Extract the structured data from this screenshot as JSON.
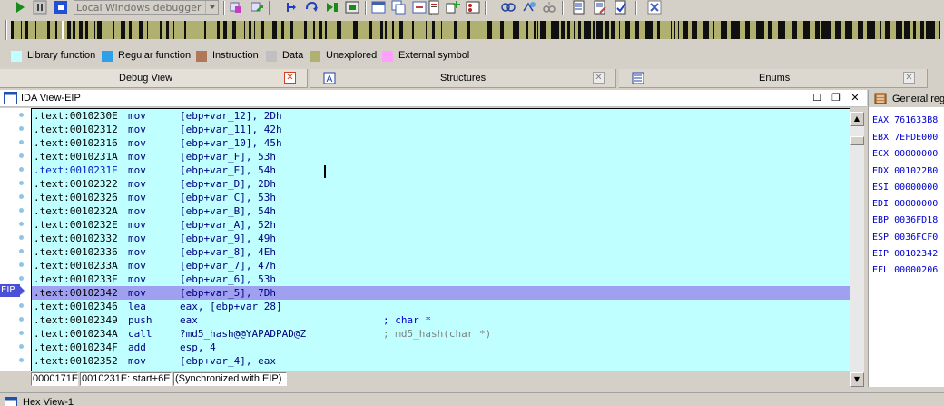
{
  "toolbar": {
    "buttons": [
      {
        "name": "start-process-button",
        "icon": "play-icon"
      },
      {
        "name": "pause-process-button",
        "icon": "pause-icon"
      },
      {
        "name": "terminate-process-button",
        "icon": "stop-icon"
      },
      {
        "name": "attach-process-button",
        "icon": "attach-icon"
      },
      {
        "name": "detach-process-button",
        "icon": "detach-icon"
      },
      {
        "name": "step-into-button",
        "icon": "step-into-icon"
      },
      {
        "name": "step-over-button",
        "icon": "step-over-icon"
      },
      {
        "name": "run-to-cursor-button",
        "icon": "run-to-cursor-icon"
      },
      {
        "name": "run-until-return-button",
        "icon": "run-until-return-icon"
      }
    ],
    "debugger_select": {
      "value": "Local Windows debugger"
    }
  },
  "legend": {
    "items": [
      {
        "label": "Library function",
        "color": "#c0ffff"
      },
      {
        "label": "Regular function",
        "color": "#2ca0e8"
      },
      {
        "label": "Instruction",
        "color": "#b07858"
      },
      {
        "label": "Data",
        "color": "#c0c0c0"
      },
      {
        "label": "Unexplored",
        "color": "#b0b070"
      },
      {
        "label": "External symbol",
        "color": "#ffa0ff"
      }
    ]
  },
  "tabs": [
    {
      "label": "Debug View",
      "active": true
    },
    {
      "label": "Structures",
      "active": false
    },
    {
      "label": "Enums",
      "active": false
    }
  ],
  "ida_view": {
    "title": "IDA View-EIP",
    "eip_marker": "EIP",
    "lines": [
      {
        "addr": ".text:0010230E",
        "mnem": "mov",
        "ops": "[ebp+var_12], 2Dh",
        "comment": "",
        "selected": false,
        "highlight": false
      },
      {
        "addr": ".text:00102312",
        "mnem": "mov",
        "ops": "[ebp+var_11], 42h",
        "comment": "",
        "selected": false,
        "highlight": false
      },
      {
        "addr": ".text:00102316",
        "mnem": "mov",
        "ops": "[ebp+var_10], 45h",
        "comment": "",
        "selected": false,
        "highlight": false
      },
      {
        "addr": ".text:0010231A",
        "mnem": "mov",
        "ops": "[ebp+var_F], 53h",
        "comment": "",
        "selected": false,
        "highlight": false
      },
      {
        "addr": ".text:0010231E",
        "mnem": "mov",
        "ops": "[ebp+var_E], 54h",
        "comment": "",
        "selected": true,
        "highlight": false
      },
      {
        "addr": ".text:00102322",
        "mnem": "mov",
        "ops": "[ebp+var_D], 2Dh",
        "comment": "",
        "selected": false,
        "highlight": false
      },
      {
        "addr": ".text:00102326",
        "mnem": "mov",
        "ops": "[ebp+var_C], 53h",
        "comment": "",
        "selected": false,
        "highlight": false
      },
      {
        "addr": ".text:0010232A",
        "mnem": "mov",
        "ops": "[ebp+var_B], 54h",
        "comment": "",
        "selected": false,
        "highlight": false
      },
      {
        "addr": ".text:0010232E",
        "mnem": "mov",
        "ops": "[ebp+var_A], 52h",
        "comment": "",
        "selected": false,
        "highlight": false
      },
      {
        "addr": ".text:00102332",
        "mnem": "mov",
        "ops": "[ebp+var_9], 49h",
        "comment": "",
        "selected": false,
        "highlight": false
      },
      {
        "addr": ".text:00102336",
        "mnem": "mov",
        "ops": "[ebp+var_8], 4Eh",
        "comment": "",
        "selected": false,
        "highlight": false
      },
      {
        "addr": ".text:0010233A",
        "mnem": "mov",
        "ops": "[ebp+var_7], 47h",
        "comment": "",
        "selected": false,
        "highlight": false
      },
      {
        "addr": ".text:0010233E",
        "mnem": "mov",
        "ops": "[ebp+var_6], 53h",
        "comment": "",
        "selected": false,
        "highlight": false
      },
      {
        "addr": ".text:00102342",
        "mnem": "mov",
        "ops": "[ebp+var_5], 7Dh",
        "comment": "",
        "selected": false,
        "highlight": true
      },
      {
        "addr": ".text:00102346",
        "mnem": "lea",
        "ops": "eax, [ebp+var_28]",
        "comment": "",
        "selected": false,
        "highlight": false
      },
      {
        "addr": ".text:00102349",
        "mnem": "push",
        "ops": "eax",
        "comment": "; char *",
        "comment_gray": false,
        "selected": false,
        "highlight": false
      },
      {
        "addr": ".text:0010234A",
        "mnem": "call",
        "ops": "?md5_hash@@YAPADPAD@Z",
        "comment": "; md5_hash(char *)",
        "comment_gray": true,
        "selected": false,
        "highlight": false
      },
      {
        "addr": ".text:0010234F",
        "mnem": "add",
        "ops": "esp, 4",
        "comment": "",
        "selected": false,
        "highlight": false
      },
      {
        "addr": ".text:00102352",
        "mnem": "mov",
        "ops": "[ebp+var_4], eax",
        "comment": "",
        "selected": false,
        "highlight": false
      }
    ],
    "status": [
      "0000171E",
      "0010231E: start+6E",
      "(Synchronized with EIP)"
    ]
  },
  "registers": {
    "title": "General regi",
    "items": [
      {
        "label": "EAX 761633B8"
      },
      {
        "label": "EBX 7EFDE000"
      },
      {
        "label": "ECX 00000000"
      },
      {
        "label": "EDX 001022B0"
      },
      {
        "label": "ESI 00000000"
      },
      {
        "label": "EDI 00000000"
      },
      {
        "label": "EBP 0036FD18"
      },
      {
        "label": "ESP 0036FCF0"
      },
      {
        "label": "EIP 00102342"
      },
      {
        "label": "EFL 00000206"
      }
    ]
  },
  "bottom_panel": {
    "title": "Hex View-1"
  }
}
